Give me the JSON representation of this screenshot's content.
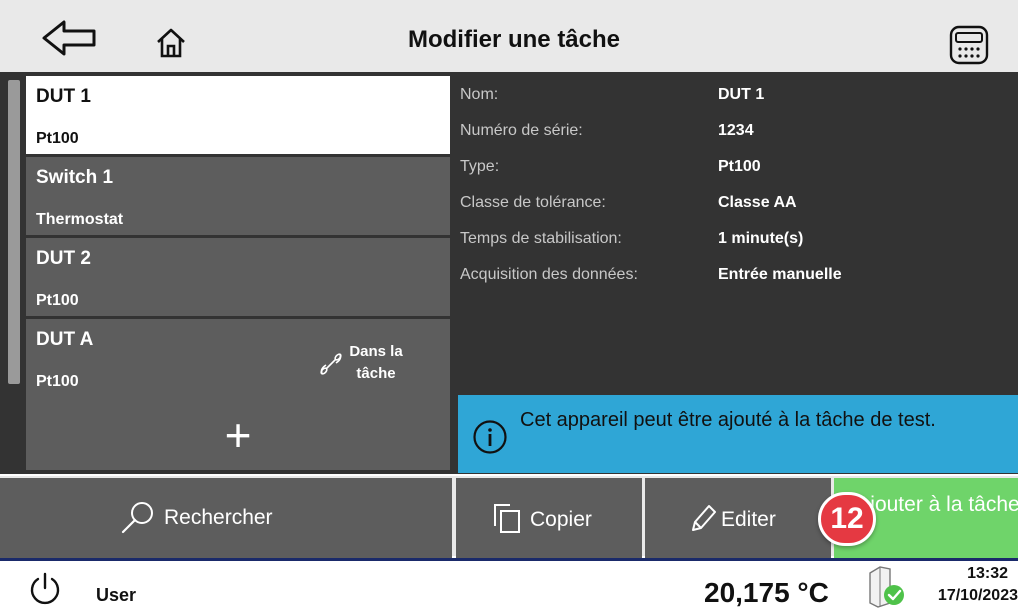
{
  "header": {
    "title": "Modifier une tâche",
    "back_icon": "back-arrow-icon",
    "home_icon": "home-icon",
    "calculator_icon": "calculator-icon"
  },
  "device_list": [
    {
      "name": "DUT 1",
      "type": "Pt100",
      "selected": true
    },
    {
      "name": "Switch 1",
      "type": "Thermostat",
      "selected": false
    },
    {
      "name": "DUT 2",
      "type": "Pt100",
      "selected": false
    },
    {
      "name": "DUT A",
      "type": "Pt100",
      "selected": false,
      "badge": "Dans la tâche"
    }
  ],
  "add_button": {
    "label": "+"
  },
  "details": [
    {
      "label": "Nom:",
      "value": "DUT 1"
    },
    {
      "label": "Numéro de série:",
      "value": "1234"
    },
    {
      "label": "Type:",
      "value": "Pt100"
    },
    {
      "label": "Classe de tolérance:",
      "value": "Classe AA"
    },
    {
      "label": "Temps de stabilisation:",
      "value": "1 minute(s)"
    },
    {
      "label": "Acquisition des données:",
      "value": "Entrée manuelle"
    }
  ],
  "info_banner": {
    "text": "Cet appareil peut être ajouté à la tâche de test.",
    "icon": "info-icon"
  },
  "actions": {
    "search": "Rechercher",
    "copy": "Copier",
    "edit": "Editer",
    "add_to_task": "Ajouter à la tâche"
  },
  "step_badge": "12",
  "statusbar": {
    "user": "User",
    "temperature": "20,175 °C",
    "time": "13:32",
    "date": "17/10/2023"
  },
  "colors": {
    "header_bg": "#e9e9e9",
    "panel_bg": "#333333",
    "item_bg": "#5d5d5d",
    "info_bg": "#2fa6d6",
    "add_task_bg": "#6fd46a",
    "badge_red": "#e53942",
    "statusbar_border": "#1a2a6a"
  }
}
